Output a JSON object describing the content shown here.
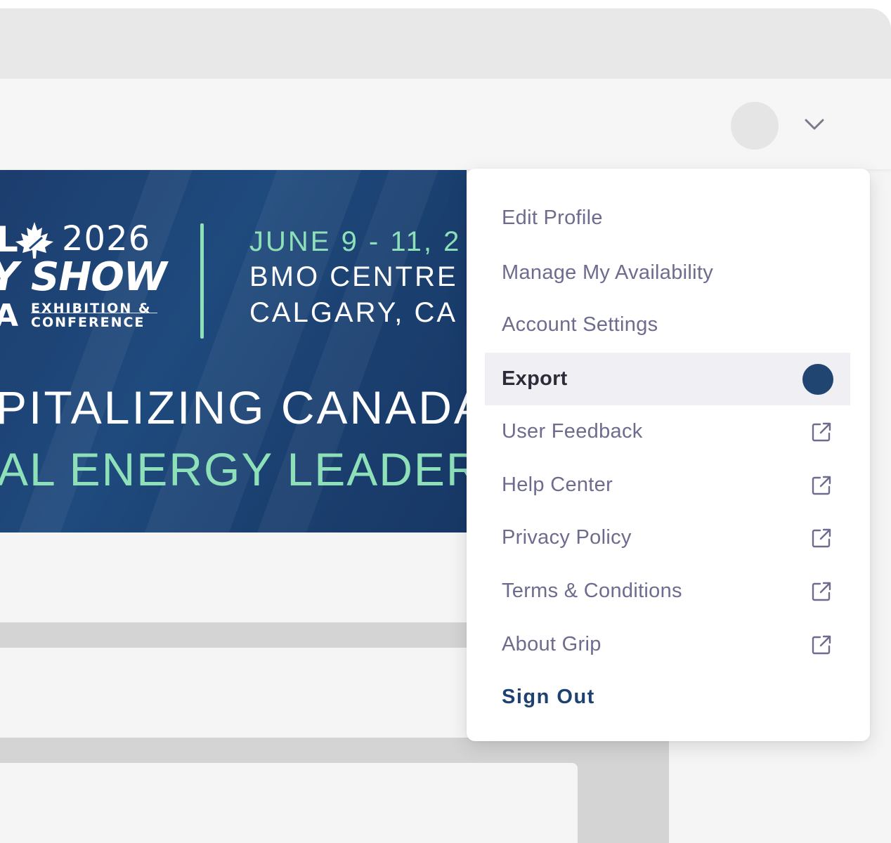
{
  "banner": {
    "year": "2026",
    "title_fragment_l": "L",
    "title_fragment_show": "Y SHOW",
    "title_fragment_a": "A",
    "subtitle_exhibition": "EXHIBITION &",
    "subtitle_conference": "CONFERENCE",
    "date": "JUNE 9 - 11, 2",
    "venue": "BMO CENTRE",
    "city": "CALGARY, CA",
    "headline_1": "PITALIZING CANADA",
    "headline_2": "AL ENERGY LEADERS",
    "colors": {
      "accent": "#8de0b8",
      "background": "#1f4a7d"
    }
  },
  "menu": {
    "items": [
      {
        "label": "Edit Profile",
        "icon": "none"
      },
      {
        "label": "Manage My Availability",
        "icon": "none"
      },
      {
        "label": "Account Settings",
        "icon": "none"
      },
      {
        "label": "Export",
        "icon": "status-dot",
        "active": true
      },
      {
        "label": "User Feedback",
        "icon": "external-link-icon"
      },
      {
        "label": "Help Center",
        "icon": "external-link-icon"
      },
      {
        "label": "Privacy Policy",
        "icon": "external-link-icon"
      },
      {
        "label": "Terms & Conditions",
        "icon": "external-link-icon"
      },
      {
        "label": "About Grip",
        "icon": "external-link-icon"
      }
    ],
    "sign_out": "Sign Out",
    "colors": {
      "item_text": "#6e6c8e",
      "active_bg": "#efeff4",
      "dot": "#1f4570",
      "sign_out": "#1d4170"
    }
  }
}
